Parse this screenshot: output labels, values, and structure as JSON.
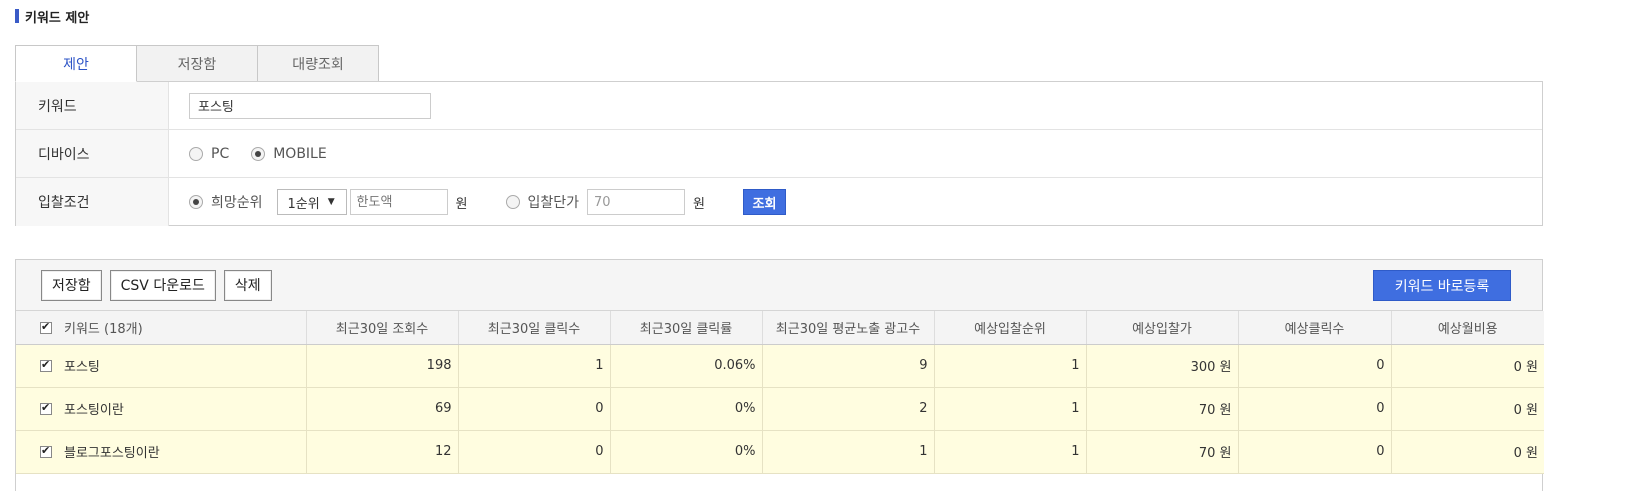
{
  "section_title": "키워드 제안",
  "tabs": [
    {
      "label": "제안",
      "active": true
    },
    {
      "label": "저장함",
      "active": false
    },
    {
      "label": "대량조회",
      "active": false
    }
  ],
  "form": {
    "keyword_label": "키워드",
    "keyword_value": "포스팅",
    "device_label": "디바이스",
    "device_options": [
      {
        "label": "PC",
        "checked": false
      },
      {
        "label": "MOBILE",
        "checked": true
      }
    ],
    "bid_label": "입찰조건",
    "bid_rank_label": "희망순위",
    "bid_rank_select": "1순위",
    "limit_placeholder": "한도액",
    "unit_won": "원",
    "bid_price_label": "입찰단가",
    "bid_price_value": "70",
    "search_button": "조회"
  },
  "toolbar": {
    "save_button": "저장함",
    "csv_button": "CSV 다운로드",
    "delete_button": "삭제",
    "register_button": "키워드 바로등록"
  },
  "table": {
    "headers": [
      "키워드 (18개)",
      "최근30일 조회수",
      "최근30일 클릭수",
      "최근30일 클릭률",
      "최근30일 평균노출 광고수",
      "예상입찰순위",
      "예상입찰가",
      "예상클릭수",
      "예상월비용"
    ],
    "rows": [
      {
        "keyword": "포스팅",
        "views": "198",
        "clicks": "1",
        "ctr": "0.06%",
        "ads": "9",
        "rank": "1",
        "bid": "300 원",
        "exp_clicks": "0",
        "cost": "0 원"
      },
      {
        "keyword": "포스팅이란",
        "views": "69",
        "clicks": "0",
        "ctr": "0%",
        "ads": "2",
        "rank": "1",
        "bid": "70 원",
        "exp_clicks": "0",
        "cost": "0 원"
      },
      {
        "keyword": "블로그포스팅이란",
        "views": "12",
        "clicks": "0",
        "ctr": "0%",
        "ads": "1",
        "rank": "1",
        "bid": "70 원",
        "exp_clicks": "0",
        "cost": "0 원"
      }
    ]
  },
  "colors": {
    "accent": "#3f6ee0",
    "row_highlight": "#fffde0"
  }
}
